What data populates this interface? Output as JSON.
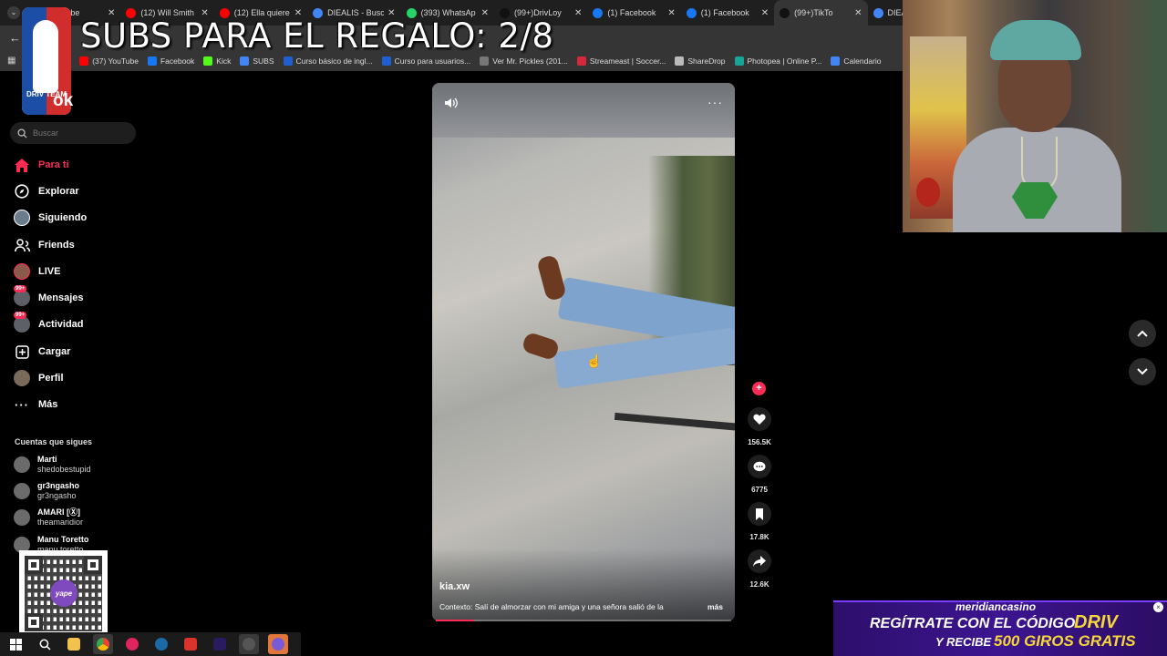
{
  "browser": {
    "tabs": [
      {
        "label": "YouTube",
        "color": "#ff0000"
      },
      {
        "label": "(12) Will Smith",
        "color": "#ff0000"
      },
      {
        "label": "(12) Ella quiere",
        "color": "#ff0000"
      },
      {
        "label": "DIEALIS - Busc",
        "color": "#4285f4"
      },
      {
        "label": "(393) WhatsAp",
        "color": "#25d366"
      },
      {
        "label": "(99+)DrivLoy",
        "color": "#111111"
      },
      {
        "label": "(1) Facebook",
        "color": "#1877f2"
      },
      {
        "label": "(1) Facebook",
        "color": "#1877f2"
      },
      {
        "label": "(99+)TikTo",
        "color": "#111111"
      },
      {
        "label": "DIEALIS -",
        "color": "#4285f4"
      }
    ],
    "bookmarks": [
      {
        "label": "WhatsApp",
        "color": "#25d366"
      },
      {
        "label": "(37) YouTube",
        "color": "#ff0000"
      },
      {
        "label": "Facebook",
        "color": "#1877f2"
      },
      {
        "label": "Kick",
        "color": "#53fc18"
      },
      {
        "label": "SUBS",
        "color": "#4285f4"
      },
      {
        "label": "Curso básico de ingl...",
        "color": "#1f5fd1"
      },
      {
        "label": "Curso para usuarios...",
        "color": "#1f5fd1"
      },
      {
        "label": "Ver Mr. Pickles (201...",
        "color": "#777777"
      },
      {
        "label": "Streameast | Soccer...",
        "color": "#d6283a"
      },
      {
        "label": "ShareDrop",
        "color": "#bbbbbb"
      },
      {
        "label": "Photopea | Online P...",
        "color": "#18a497"
      },
      {
        "label": "Calendario",
        "color": "#4285f4"
      }
    ]
  },
  "overlay": {
    "title": "SUBS PARA EL REGALO: 2/8",
    "logo_text": "DRIV TEAM"
  },
  "sidebar": {
    "logo": "ok",
    "search_placeholder": "Buscar",
    "nav": [
      {
        "label": "Para ti",
        "icon": "home-icon",
        "active": true
      },
      {
        "label": "Explorar",
        "icon": "compass-icon"
      },
      {
        "label": "Siguiendo",
        "icon": "following-icon"
      },
      {
        "label": "Friends",
        "icon": "friends-icon"
      },
      {
        "label": "LIVE",
        "icon": "live-icon"
      },
      {
        "label": "Mensajes",
        "icon": "messages-icon",
        "badge": "99+"
      },
      {
        "label": "Actividad",
        "icon": "activity-icon",
        "badge": "99+"
      },
      {
        "label": "Cargar",
        "icon": "upload-icon"
      },
      {
        "label": "Perfil",
        "icon": "profile-icon"
      },
      {
        "label": "Más",
        "icon": "more-icon"
      }
    ],
    "following_header": "Cuentas que sigues",
    "accounts": [
      {
        "name": "Marti",
        "username": "shedobestupid"
      },
      {
        "name": "gr3ngasho",
        "username": "gr3ngasho"
      },
      {
        "name": "AMARI [Ⓧ]",
        "username": "theamaridior"
      },
      {
        "name": "Manu Toretto",
        "username": "manu.toretto"
      }
    ],
    "qr_label": "yape"
  },
  "video": {
    "author": "kia.xw",
    "description": "Contexto: Salí de almorzar con mi amiga y una señora salió de la",
    "more_label": "más",
    "progress": 0.13,
    "likes": "156.5K",
    "comments": "6775",
    "saves": "17.8K",
    "shares": "12.6K"
  },
  "casino": {
    "brand": "meridiancasino",
    "line1": "REGÍTRATE CON EL CÓDIGO",
    "code": "DRIV",
    "line2a": "Y RECIBE",
    "line2b": "500 GIROS GRATIS"
  },
  "colors": {
    "accent": "#fe2c55",
    "background": "#000000",
    "casino_purple": "#3c1590",
    "casino_gold": "#f5d63b"
  }
}
